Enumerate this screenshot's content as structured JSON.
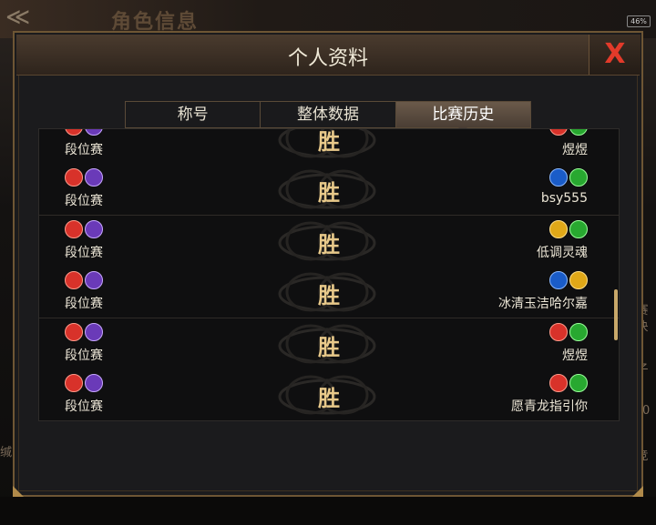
{
  "background": {
    "title": "角色信息",
    "battery": "46%",
    "side_right": [
      "赛",
      "决",
      "子",
      "00",
      "竞"
    ],
    "side_left": [
      "缄"
    ]
  },
  "dialog": {
    "title": "个人资料",
    "close_label": "X",
    "tabs": [
      {
        "label": "称号",
        "active": false
      },
      {
        "label": "整体数据",
        "active": false
      },
      {
        "label": "比赛历史",
        "active": true
      }
    ]
  },
  "matches": [
    {
      "mode": "段位赛",
      "result": "胜",
      "player": "煜煜",
      "opponent_icons": [
        "red",
        "green"
      ]
    },
    {
      "mode": "段位赛",
      "result": "胜",
      "player": "bsy555",
      "opponent_icons": [
        "blue",
        "green"
      ]
    },
    {
      "mode": "段位赛",
      "result": "胜",
      "player": "低调灵魂",
      "opponent_icons": [
        "yellow",
        "green"
      ]
    },
    {
      "mode": "段位赛",
      "result": "胜",
      "player": "冰清玉洁哈尔嘉",
      "opponent_icons": [
        "blue",
        "yellow"
      ]
    },
    {
      "mode": "段位赛",
      "result": "胜",
      "player": "煜煜",
      "opponent_icons": [
        "red",
        "green"
      ]
    },
    {
      "mode": "段位赛",
      "result": "胜",
      "player": "愿青龙指引你",
      "opponent_icons": [
        "red",
        "green"
      ]
    }
  ],
  "colors": {
    "accent_gold": "#c8a86a",
    "close_red": "#e23a2a",
    "win_text": "#e8c98a"
  }
}
